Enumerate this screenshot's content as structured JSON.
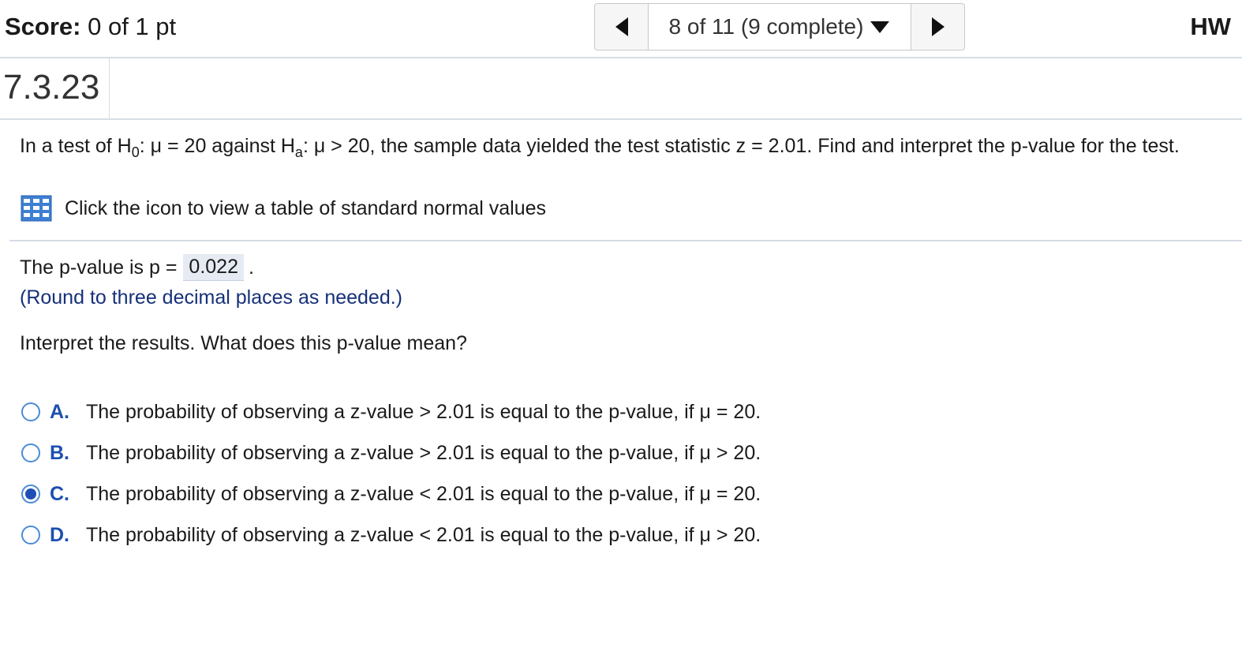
{
  "header": {
    "score_label": "Score:",
    "score_value": "0 of 1 pt",
    "nav_position": "8 of 11 (9 complete)",
    "hw_label": "HW"
  },
  "question_number": "7.3.23",
  "question": {
    "part1": "In a test of H",
    "sub0": "0",
    "part2": ": μ = 20 against H",
    "suba": "a",
    "part3": ": μ > 20, the sample data yielded the test statistic z = 2.01. Find and interpret the p-value for the test."
  },
  "table_link_text": "Click the icon to view a table of standard normal values",
  "pvalue": {
    "prefix": "The p-value is p =",
    "answer": "0.022",
    "suffix": ".",
    "note": "(Round to three decimal places as needed.)"
  },
  "interpret_prompt": "Interpret the results. What does this p-value mean?",
  "options": [
    {
      "letter": "A.",
      "text": "The probability of observing a z-value > 2.01 is equal to the p-value, if μ = 20."
    },
    {
      "letter": "B.",
      "text": "The probability of observing a z-value > 2.01 is equal to the p-value, if μ > 20."
    },
    {
      "letter": "C.",
      "text": "The probability of observing a z-value < 2.01 is equal to the p-value, if μ = 20."
    },
    {
      "letter": "D.",
      "text": "The probability of observing a z-value < 2.01 is equal to the p-value, if μ > 20."
    }
  ],
  "selected_option": "C.",
  "colors": {
    "accent_blue": "#1d4fb0",
    "note_blue": "#16307a",
    "answer_bg": "#e6ebf3",
    "divider": "#d6dde6"
  }
}
